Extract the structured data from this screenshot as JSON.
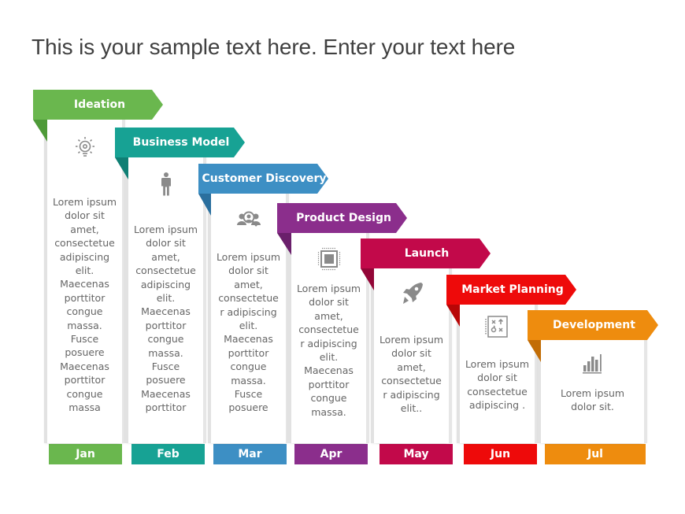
{
  "title": "This is your sample text here. Enter your text here",
  "stages": [
    {
      "label": "Ideation",
      "color": "#6ab74e",
      "fold": "#4e9a38",
      "icon": "lightbulb-icon",
      "month": "Jan",
      "text": "Lorem ipsum\ndolor sit\namet,\nconsectetue\nadipiscing\nelit.\nMaecenas\nporttitor\ncongue\nmassa.\nFusce\nposuere\nMaecenas\nporttitor\ncongue\nmassa"
    },
    {
      "label": "Business Model",
      "color": "#17a294",
      "fold": "#0f7f74",
      "icon": "person-icon",
      "month": "Feb",
      "text": "Lorem ipsum\ndolor sit\namet,\nconsectetue\nadipiscing\nelit.\nMaecenas\nporttitor\ncongue\nmassa.\nFusce\nposuere\nMaecenas\nporttitor"
    },
    {
      "label": "Customer Discovery",
      "color": "#3d8fc4",
      "fold": "#2a6f9e",
      "icon": "user-search-icon",
      "month": "Mar",
      "text": "Lorem ipsum\ndolor sit\namet,\nconsectetue\nr adipiscing\nelit.\nMaecenas\nporttitor\ncongue\nmassa.\nFusce\nposuere"
    },
    {
      "label": "Product Design",
      "color": "#8b2e8c",
      "fold": "#6a1f6b",
      "icon": "chip-icon",
      "month": "Apr",
      "text": "Lorem ipsum\ndolor sit\namet,\nconsectetue\nr adipiscing\nelit.\nMaecenas\nporttitor\ncongue\nmassa."
    },
    {
      "label": "Launch",
      "color": "#c2094a",
      "fold": "#930637",
      "icon": "rocket-icon",
      "month": "May",
      "text": "Lorem ipsum\ndolor sit\namet,\nconsectetue\nr adipiscing\nelit.."
    },
    {
      "label": "Market Planning",
      "color": "#ee0a0a",
      "fold": "#b80606",
      "icon": "strategy-board-icon",
      "month": "Jun",
      "text": "Lorem ipsum\ndolor sit\nconsectetue\nadipiscing ."
    },
    {
      "label": "Development",
      "color": "#ee8c0e",
      "fold": "#c26d06",
      "icon": "bar-chart-icon",
      "month": "Jul",
      "text": "Lorem ipsum\ndolor sit."
    }
  ]
}
